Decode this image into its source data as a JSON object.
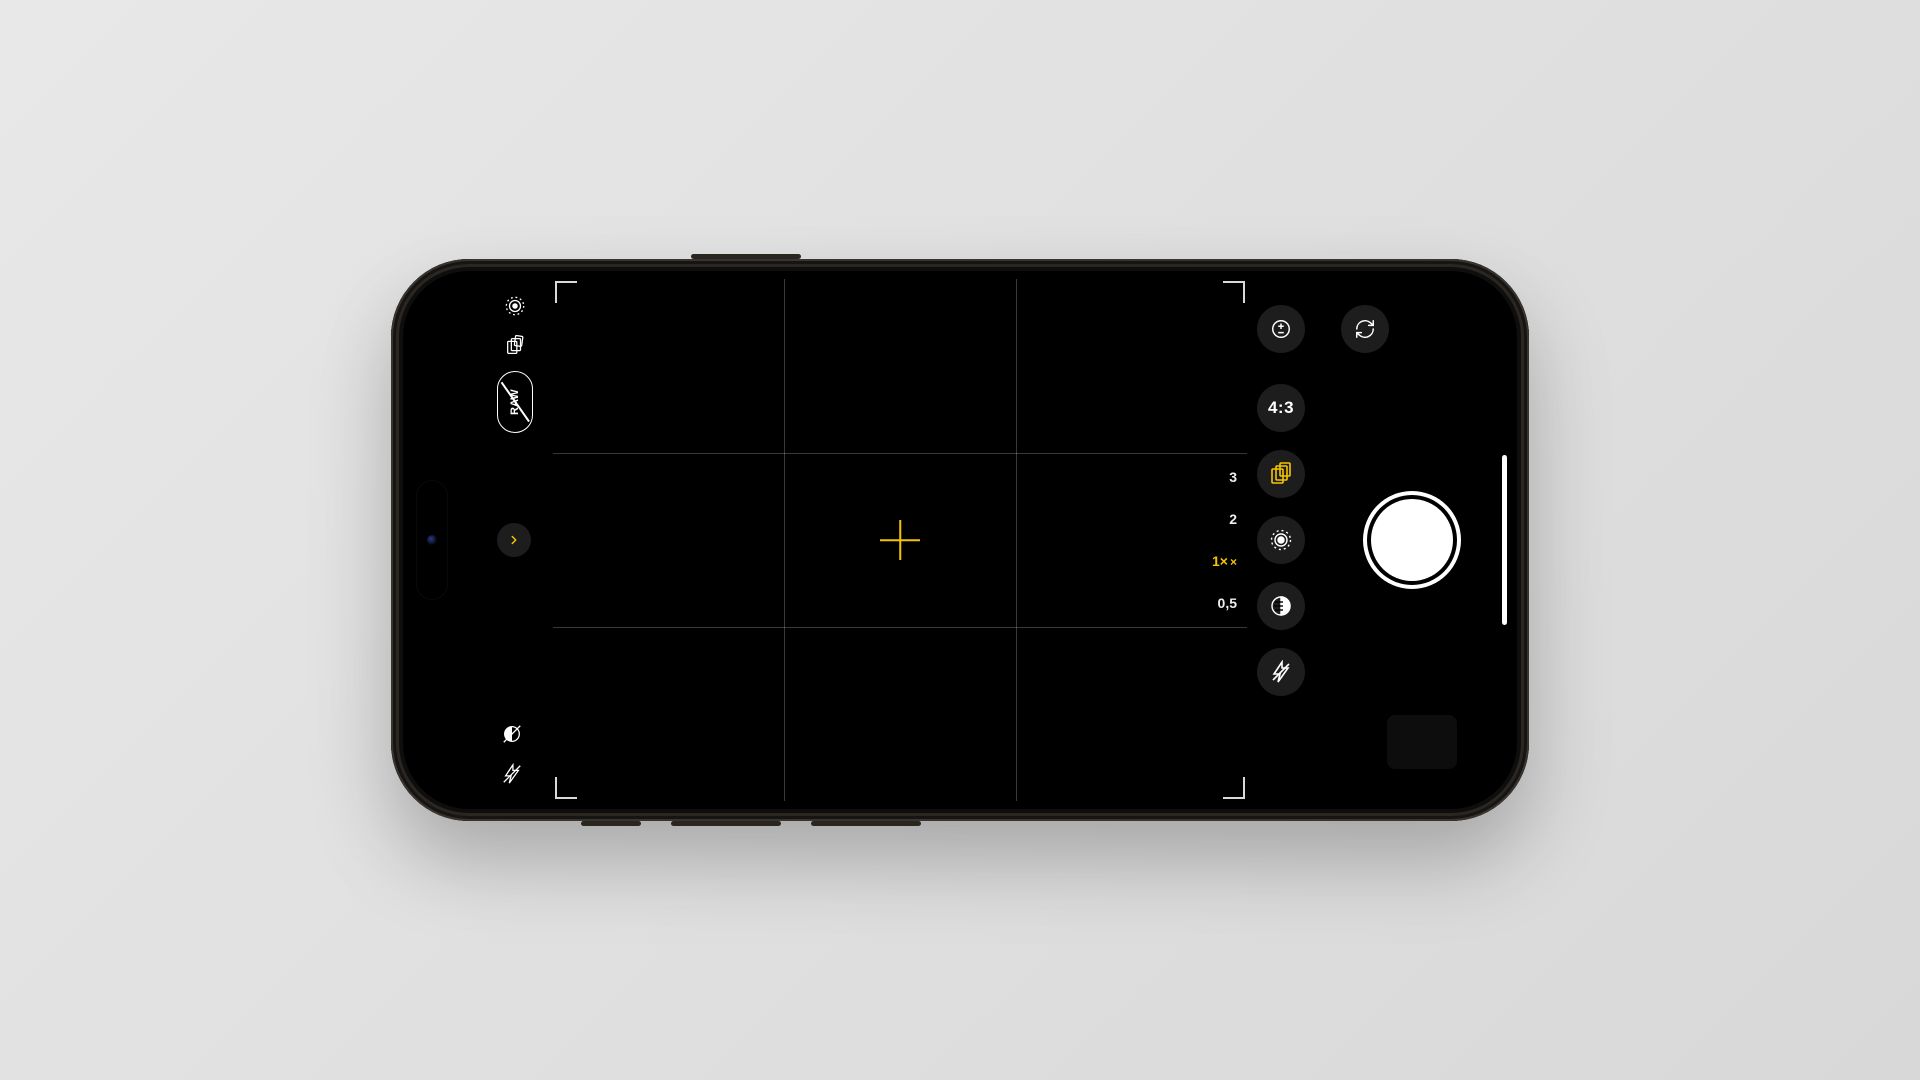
{
  "camera": {
    "raw_label": "RAW",
    "aspect_ratio": "4:3",
    "zoom": {
      "levels": [
        "3",
        "2",
        "1",
        "0,5"
      ],
      "active_index": 2,
      "active_suffix": "×"
    },
    "accent_color": "#f6c500",
    "left_controls": {
      "top": [
        "live-photo-icon",
        "photographic-styles-icon",
        "raw-toggle"
      ],
      "expand": "chevron-right-icon",
      "bottom": [
        "night-mode-off-icon",
        "flash-off-icon"
      ]
    },
    "right_controls": {
      "top_pair": [
        "exposure-icon",
        "camera-flip-icon"
      ],
      "stack": [
        "aspect-ratio",
        "photographic-styles-icon",
        "live-photo-icon",
        "filters-icon",
        "flash-off-icon"
      ],
      "active_stack_index": 1
    }
  }
}
